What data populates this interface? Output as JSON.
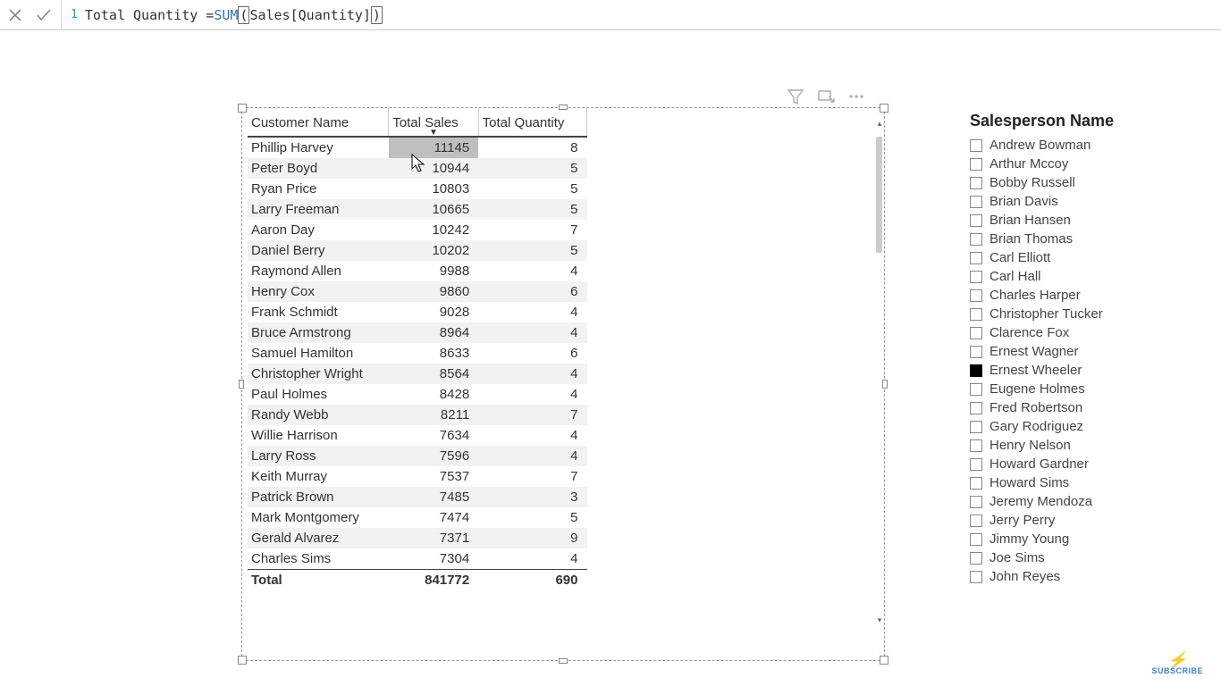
{
  "formula": {
    "line_number": "1",
    "prefix": "Total Quantity = ",
    "func": "SUM",
    "open": "(",
    "arg": " Sales[Quantity] ",
    "close": ")"
  },
  "table": {
    "headers": [
      "Customer Name",
      "Total Sales",
      "Total Quantity"
    ],
    "sorted_col_index": 1,
    "rows": [
      {
        "name": "Phillip Harvey",
        "sales": "11145",
        "qty": "8"
      },
      {
        "name": "Peter Boyd",
        "sales": "10944",
        "qty": "5"
      },
      {
        "name": "Ryan Price",
        "sales": "10803",
        "qty": "5"
      },
      {
        "name": "Larry Freeman",
        "sales": "10665",
        "qty": "5"
      },
      {
        "name": "Aaron Day",
        "sales": "10242",
        "qty": "7"
      },
      {
        "name": "Daniel Berry",
        "sales": "10202",
        "qty": "5"
      },
      {
        "name": "Raymond Allen",
        "sales": "9988",
        "qty": "4"
      },
      {
        "name": "Henry Cox",
        "sales": "9860",
        "qty": "6"
      },
      {
        "name": "Frank Schmidt",
        "sales": "9028",
        "qty": "4"
      },
      {
        "name": "Bruce Armstrong",
        "sales": "8964",
        "qty": "4"
      },
      {
        "name": "Samuel Hamilton",
        "sales": "8633",
        "qty": "6"
      },
      {
        "name": "Christopher Wright",
        "sales": "8564",
        "qty": "4"
      },
      {
        "name": "Paul Holmes",
        "sales": "8428",
        "qty": "4"
      },
      {
        "name": "Randy Webb",
        "sales": "8211",
        "qty": "7"
      },
      {
        "name": "Willie Harrison",
        "sales": "7634",
        "qty": "4"
      },
      {
        "name": "Larry Ross",
        "sales": "7596",
        "qty": "4"
      },
      {
        "name": "Keith Murray",
        "sales": "7537",
        "qty": "7"
      },
      {
        "name": "Patrick Brown",
        "sales": "7485",
        "qty": "3"
      },
      {
        "name": "Mark Montgomery",
        "sales": "7474",
        "qty": "5"
      },
      {
        "name": "Gerald Alvarez",
        "sales": "7371",
        "qty": "9"
      },
      {
        "name": "Charles Sims",
        "sales": "7304",
        "qty": "4"
      }
    ],
    "total": {
      "label": "Total",
      "sales": "841772",
      "qty": "690"
    }
  },
  "slicer": {
    "title": "Salesperson Name",
    "items": [
      {
        "label": "Andrew Bowman",
        "checked": false
      },
      {
        "label": "Arthur Mccoy",
        "checked": false
      },
      {
        "label": "Bobby Russell",
        "checked": false
      },
      {
        "label": "Brian Davis",
        "checked": false
      },
      {
        "label": "Brian Hansen",
        "checked": false
      },
      {
        "label": "Brian Thomas",
        "checked": false
      },
      {
        "label": "Carl Elliott",
        "checked": false
      },
      {
        "label": "Carl Hall",
        "checked": false
      },
      {
        "label": "Charles Harper",
        "checked": false
      },
      {
        "label": "Christopher Tucker",
        "checked": false
      },
      {
        "label": "Clarence Fox",
        "checked": false
      },
      {
        "label": "Ernest Wagner",
        "checked": false
      },
      {
        "label": "Ernest Wheeler",
        "checked": true
      },
      {
        "label": "Eugene Holmes",
        "checked": false
      },
      {
        "label": "Fred Robertson",
        "checked": false
      },
      {
        "label": "Gary Rodriguez",
        "checked": false
      },
      {
        "label": "Henry Nelson",
        "checked": false
      },
      {
        "label": "Howard Gardner",
        "checked": false
      },
      {
        "label": "Howard Sims",
        "checked": false
      },
      {
        "label": "Jeremy Mendoza",
        "checked": false
      },
      {
        "label": "Jerry Perry",
        "checked": false
      },
      {
        "label": "Jimmy Young",
        "checked": false
      },
      {
        "label": "Joe Sims",
        "checked": false
      },
      {
        "label": "John Reyes",
        "checked": false
      }
    ]
  },
  "subscribe_label": "SUBSCRIBE"
}
